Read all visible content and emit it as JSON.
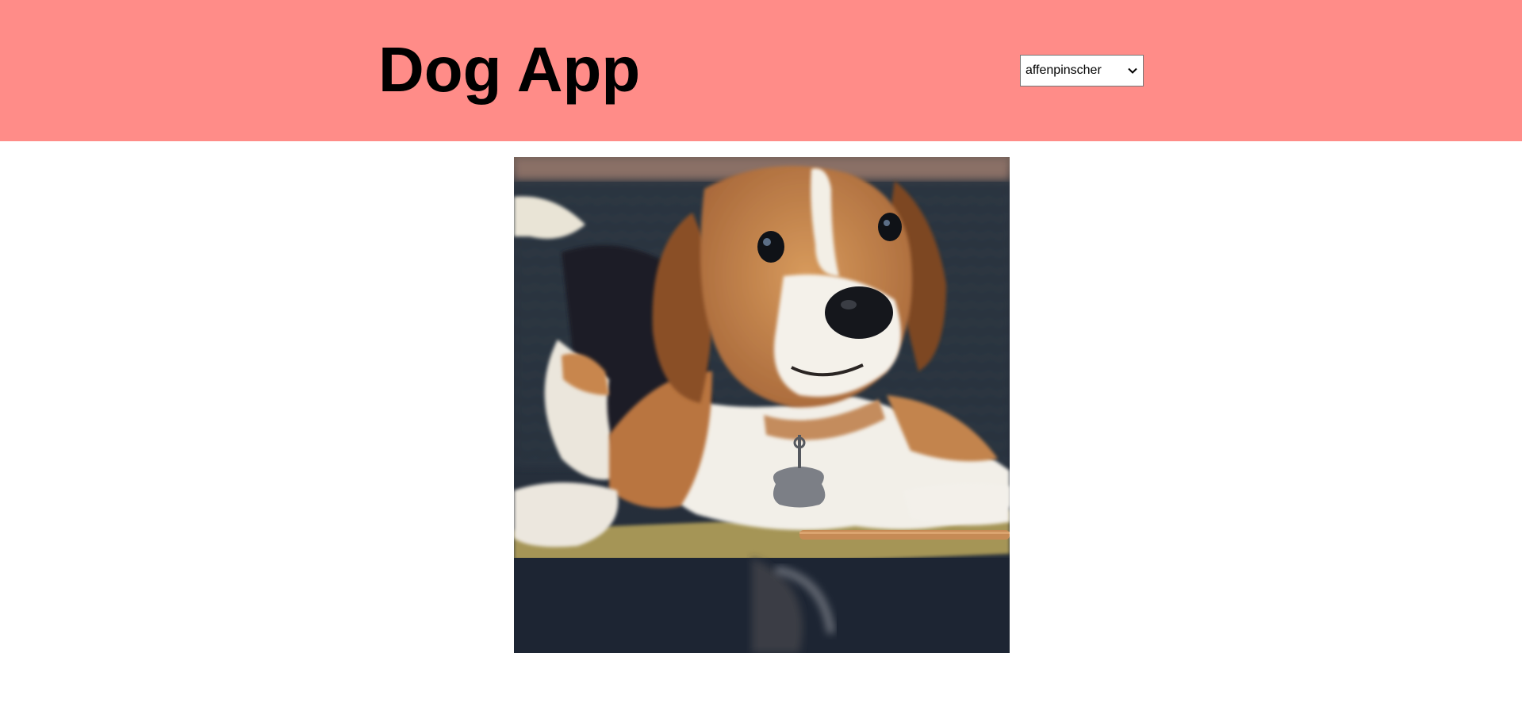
{
  "header": {
    "title": "Dog App",
    "background_color": "#ff8c88"
  },
  "breed_select": {
    "selected": "affenpinscher",
    "icon": "chevron-down-icon"
  },
  "main": {
    "image": {
      "subject": "beagle-photo"
    }
  }
}
